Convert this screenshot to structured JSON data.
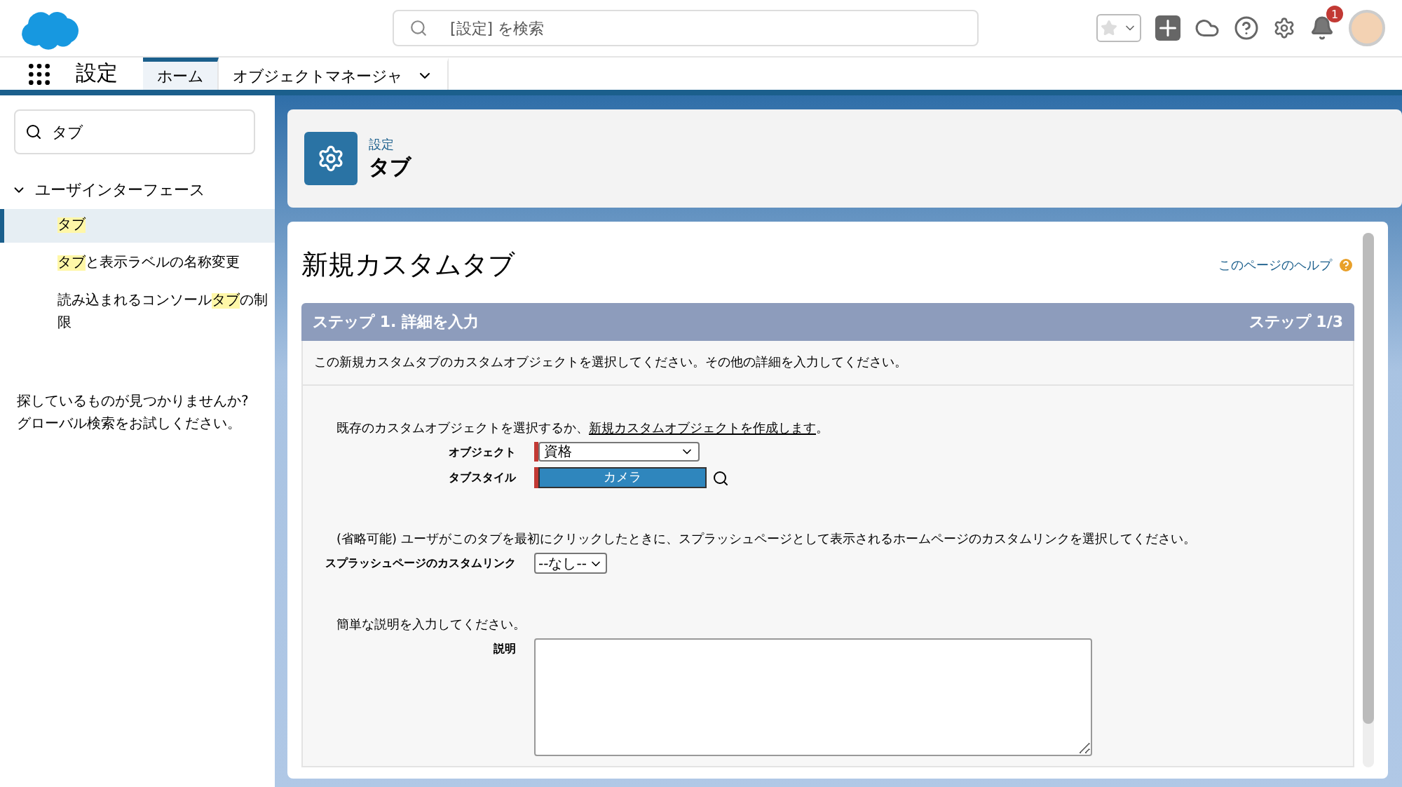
{
  "header": {
    "search": {
      "placeholder": "[設定] を検索"
    },
    "notifications": "1"
  },
  "nav": {
    "app_name": "設定",
    "tabs": [
      {
        "label": "ホーム",
        "selected": true,
        "dropdown": false
      },
      {
        "label": "オブジェクトマネージャ",
        "selected": false,
        "dropdown": true
      }
    ]
  },
  "sidebar": {
    "search": {
      "value": "タブ"
    },
    "tree": [
      {
        "label": "ユーザインターフェース",
        "expanded": true,
        "children": [
          {
            "segments": [
              {
                "text": "タブ",
                "match": true
              }
            ],
            "selected": true
          },
          {
            "segments": [
              {
                "text": "タブ",
                "match": true
              },
              {
                "text": "と表示ラベルの名称変更",
                "match": false
              }
            ],
            "selected": false
          },
          {
            "segments": [
              {
                "text": "読み込まれるコンソール",
                "match": false
              },
              {
                "text": "タブ",
                "match": true
              },
              {
                "text": "の制限",
                "match": false
              }
            ],
            "selected": false
          }
        ]
      }
    ],
    "hint": [
      "探しているものが見つかりませんか?",
      "グローバル検索をお試しください。"
    ]
  },
  "page_header": {
    "breadcrumb": "設定",
    "title": "タブ"
  },
  "content": {
    "title": "新規カスタムタブ",
    "help_link": "このページのヘルプ",
    "step": {
      "title": "ステップ 1. 詳細を入力",
      "counter": "ステップ 1/3"
    },
    "intro": "この新規カスタムタブのカスタムオブジェクトを選択してください。その他の詳細を入力してください。",
    "object_prompt": "既存のカスタムオブジェクトを選択するか、",
    "object_link": "新規カスタムオブジェクトを作成します",
    "object_prompt_end": "。",
    "fields": [
      {
        "kind": "select",
        "label": "オブジェクト",
        "value": "資格",
        "required": true
      },
      {
        "kind": "style",
        "label": "タブスタイル",
        "value": "カメラ",
        "required": true
      }
    ],
    "splash_prompt": "(省略可能) ユーザがこのタブを最初にクリックしたときに、スプラッシュページとして表示されるホームページのカスタムリンクを選択してください。",
    "splash": {
      "label": "スプラッシュページのカスタムリンク",
      "value": "--なし--"
    },
    "desc_prompt": "簡単な説明を入力してください。",
    "desc": {
      "label": "説明"
    }
  }
}
